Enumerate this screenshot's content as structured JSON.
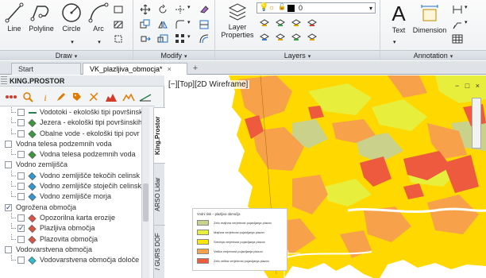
{
  "ribbon": {
    "draw": {
      "title": "Draw",
      "tools": [
        {
          "label": "Line",
          "icon": "line-icon"
        },
        {
          "label": "Polyline",
          "icon": "polyline-icon"
        },
        {
          "label": "Circle",
          "icon": "circle-icon"
        },
        {
          "label": "Arc",
          "icon": "arc-icon"
        }
      ]
    },
    "modify": {
      "title": "Modify"
    },
    "layers": {
      "title": "Layers",
      "properties_label": "Layer Properties",
      "current_layer": "0"
    },
    "annotation": {
      "title": "Annotation",
      "tools": [
        {
          "label": "Text",
          "icon": "text-icon"
        },
        {
          "label": "Dimension",
          "icon": "dimension-icon"
        }
      ]
    }
  },
  "tabs": {
    "items": [
      {
        "label": "Start"
      },
      {
        "label": "VK_plazljiva_obmocja*"
      }
    ],
    "add_label": "+"
  },
  "left_panel": {
    "title": "KING.PROSTOR",
    "layers": [
      {
        "label": "Vodotoki - ekološki tipi površinsk",
        "indent": 2,
        "checked": false,
        "symbol": "line",
        "color": "#2e7d4f"
      },
      {
        "label": "Jezera - ekološki tipi površinskih",
        "indent": 2,
        "checked": false,
        "symbol": "poly",
        "color": "#3a9a3a"
      },
      {
        "label": "Obalne vode - ekološki tipi povr",
        "indent": 2,
        "checked": false,
        "symbol": "poly",
        "color": "#3a9a3a"
      },
      {
        "label": "Vodna telesa podzemnih voda",
        "indent": 1,
        "checked": false,
        "symbol": "none",
        "color": ""
      },
      {
        "label": "Vodna telesa podzemnih voda",
        "indent": 2,
        "checked": false,
        "symbol": "poly",
        "color": "#3a9a3a"
      },
      {
        "label": "Vodno zemljišča",
        "indent": 1,
        "checked": false,
        "symbol": "none",
        "color": ""
      },
      {
        "label": "Vodno zemljišče tekočih celinsk",
        "indent": 2,
        "checked": false,
        "symbol": "poly",
        "color": "#2d9ad6"
      },
      {
        "label": "Vodno zemljišče stoječih celinsk",
        "indent": 2,
        "checked": false,
        "symbol": "poly",
        "color": "#2d9ad6"
      },
      {
        "label": "Vodno zemljišče morja",
        "indent": 2,
        "checked": false,
        "symbol": "poly",
        "color": "#2d9ad6"
      },
      {
        "label": "Ogrožena območja",
        "indent": 1,
        "checked": true,
        "symbol": "none",
        "color": ""
      },
      {
        "label": "Opozorilna karta erozije",
        "indent": 2,
        "checked": false,
        "symbol": "poly",
        "color": "#e0523e"
      },
      {
        "label": "Plazljiva območja",
        "indent": 2,
        "checked": true,
        "symbol": "poly",
        "color": "#e0523e"
      },
      {
        "label": "Plazovita območja",
        "indent": 2,
        "checked": false,
        "symbol": "poly",
        "color": "#e0523e"
      },
      {
        "label": "Vodovarstvena območja",
        "indent": 1,
        "checked": false,
        "symbol": "none",
        "color": ""
      },
      {
        "label": "Vodovarstvena območja določe",
        "indent": 2,
        "checked": false,
        "symbol": "poly",
        "color": "#2bbfd1"
      }
    ],
    "side_tabs": [
      {
        "label": "King.Prostor"
      },
      {
        "label": "ARSO Lidar"
      },
      {
        "label": "/ GURS DOF"
      }
    ]
  },
  "viewport": {
    "label": "[−][Top][2D Wireframe]",
    "window_controls": [
      "−",
      "□",
      "×"
    ],
    "legend": {
      "title": "Vodni tisk – plazljiva območja",
      "items": [
        {
          "label": "Zelo majhna verjetnost pojavljanja plazov",
          "color": "#c9d18a"
        },
        {
          "label": "Majhna verjetnost pojavljanja plazov",
          "color": "#e7ee3c"
        },
        {
          "label": "Srednja verjetnost pojavljanja plazov",
          "color": "#ffe800"
        },
        {
          "label": "Velika verjetnost pojavljanja plazov",
          "color": "#f7a24a"
        },
        {
          "label": "Zelo velika verjetnost pojavljanja plazov",
          "color": "#ed5a3d"
        }
      ]
    }
  }
}
